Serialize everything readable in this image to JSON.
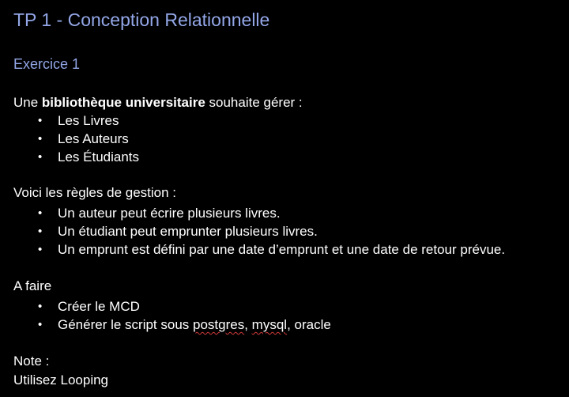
{
  "title": "TP 1 - Conception Relationnelle",
  "exercise_heading": "Exercice 1",
  "intro": {
    "prefix": "Une ",
    "bold": "bibliothèque universitaire",
    "suffix": " souhaite gérer :"
  },
  "entities": [
    "Les Livres",
    "Les Auteurs",
    "Les Étudiants"
  ],
  "rules_heading": "Voici les règles de gestion :",
  "rules": [
    "Un auteur peut écrire plusieurs livres.",
    "Un étudiant peut emprunter plusieurs livres.",
    "Un emprunt est défini par une date d’emprunt et une date de retour prévue."
  ],
  "todo_heading": "A faire",
  "todo": {
    "item1": "Créer le MCD",
    "item2": {
      "before": "Générer le script sous ",
      "word1": "postgres",
      "sep": ", ",
      "word2": "mysql",
      "after": ", oracle"
    }
  },
  "note_heading": "Note :",
  "note_text": "Utilisez Looping",
  "bullet_glyph": "•",
  "colors": {
    "background": "#000000",
    "text": "#ffffff",
    "heading": "#93a7e8",
    "spellcheck": "#d23a3a"
  }
}
